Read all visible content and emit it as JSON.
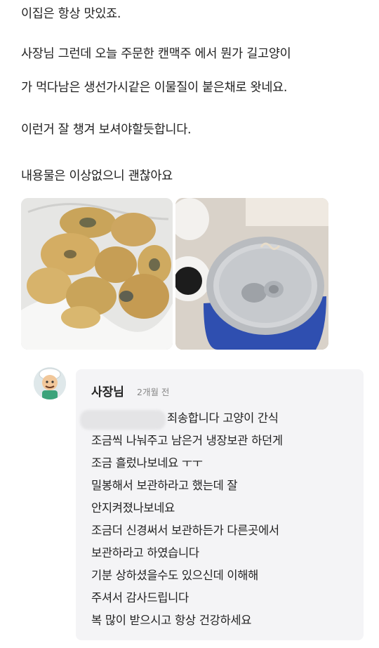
{
  "review": {
    "lines": [
      "이집은 항상 맛있죠.",
      "사장님 그런데 오늘 주문한 캔맥주 에서 뭔가 길고양이",
      "가 먹다남은 생선가시같은 이물질이 붙은채로 왓네요.",
      "이런거 잘 챙겨 보셔야할듯합니다.",
      "내용물은 이상없으니 괜찮아요"
    ]
  },
  "photos": [
    {
      "icon": "fried-food-photo"
    },
    {
      "icon": "beer-can-photo"
    }
  ],
  "reply": {
    "author": "사장님",
    "time": "2개월 전",
    "lines": [
      "죄송합니다 고양이 간식",
      "조금씩 나눠주고 남은거 냉장보관 하던게",
      "조금 흘렀나보네요 ㅜㅜ",
      "밀봉해서 보관하라고 했는데 잘",
      "안지켜졌나보네요",
      "조금더 신경써서 보관하든가 다른곳에서",
      "보관하라고 하였습니다",
      "기분 상하셨을수도 있으신데 이해해",
      "주셔서 감사드립니다",
      "복 많이 받으시고 항상 건강하세요"
    ]
  },
  "colors": {
    "reply_bg": "#f4f4f6",
    "can_blue": "#2f4fb0"
  }
}
